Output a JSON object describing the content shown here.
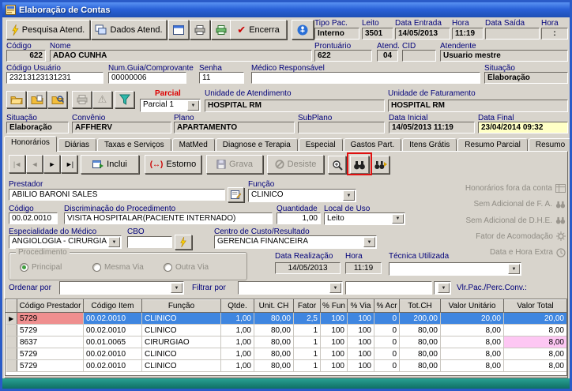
{
  "window": {
    "title": "Elaboração de Contas"
  },
  "icons": {
    "chevron_down": "▼",
    "check": "✔",
    "warning": "⚠",
    "prev_end": "|◄",
    "prev": "◄",
    "next": "►",
    "next_end": "►|",
    "estorno_glyph": "(↔)",
    "row_pointer": "▶"
  },
  "annotation_color": "#e01010",
  "toolbar": {
    "pesquisa_label": "Pesquisa Atend.",
    "dados_label": "Dados Atend.",
    "encerra_label": "Encerra"
  },
  "patient": {
    "tipo_pac_label": "Tipo Pac.",
    "tipo_pac": "Interno",
    "leito_label": "Leito",
    "leito": "3501",
    "data_entrada_label": "Data Entrada",
    "data_entrada": "14/05/2013",
    "hora_entrada_label": "Hora",
    "hora_entrada": "11:19",
    "data_saida_label": "Data Saída",
    "data_saida": "",
    "hora_saida_label": "Hora",
    "hora_saida": ":",
    "codigo_label": "Código",
    "codigo": "622",
    "nome_label": "Nome",
    "nome": "ADAO CUNHA",
    "prontuario_label": "Prontuário",
    "prontuario": "622",
    "atend_label": "Atend.",
    "atend": "04",
    "cid_label": "CID",
    "cid": "",
    "atendente_label": "Atendente",
    "atendente": "Usuario mestre",
    "codigo_usuario_label": "Código Usuário",
    "codigo_usuario": "23213123131231",
    "num_guia_label": "Num.Guia/Comprovante",
    "num_guia": "00000006",
    "senha_label": "Senha",
    "senha": "11",
    "medico_resp_label": "Médico Responsável",
    "medico_resp": "",
    "situacao_label": "Situação",
    "situacao": "Elaboração"
  },
  "conta": {
    "parcial_label": "Parcial",
    "parcial": "Parcial 1",
    "unid_atend_label": "Unidade de Atendimento",
    "unid_atend": "HOSPITAL RM",
    "unid_fat_label": "Unidade de Faturamento",
    "unid_fat": "HOSPITAL RM",
    "situacao_label": "Situação",
    "situacao": "Elaboração",
    "convenio_label": "Convênio",
    "convenio": "AFFHERV",
    "plano_label": "Plano",
    "plano": "APARTAMENTO",
    "subplano_label": "SubPlano",
    "subplano": "",
    "data_inicial_label": "Data Inicial",
    "data_inicial": "14/05/2013 11:19",
    "data_final_label": "Data Final",
    "data_final": "23/04/2014 09:32"
  },
  "tabs": {
    "items": [
      {
        "label": "Honorários",
        "active": true
      },
      {
        "label": "Diárias"
      },
      {
        "label": "Taxas e Serviços"
      },
      {
        "label": "MatMed"
      },
      {
        "label": "Diagnose e Terapia"
      },
      {
        "label": "Especial"
      },
      {
        "label": "Gastos Part."
      },
      {
        "label": "Itens Grátis"
      },
      {
        "label": "Resumo Parcial"
      },
      {
        "label": "Resumo"
      }
    ]
  },
  "honorarios": {
    "inclui": "Inclui",
    "estorno": "Estorno",
    "grava": "Grava",
    "desiste": "Desiste",
    "prestador_label": "Prestador",
    "prestador": "ABILIO BARONI SALES",
    "funcao_label": "Função",
    "funcao": "CLINICO",
    "codigo_label": "Código",
    "codigo": "00.02.0010",
    "discriminacao_label": "Discriminação do Procedimento",
    "discriminacao": "VISITA HOSPITALAR(PACIENTE INTERNADO)",
    "quantidade_label": "Quantidade",
    "quantidade": "1,00",
    "local_uso_label": "Local de Uso",
    "local_uso": "Leito",
    "especialidade_label": "Especialidade do Médico",
    "especialidade": "ANGIOLOGIA - CIRURGIA VA",
    "cbo_label": "CBO",
    "cbo": "",
    "centro_custo_label": "Centro de Custo/Resultado",
    "centro_custo": "GERENCIA FINANCEIRA",
    "procedimento_label": "Procedimento",
    "radio_principal": "Principal",
    "radio_mesma_via": "Mesma Via",
    "radio_outra_via": "Outra Via",
    "data_realizacao_label": "Data Realização",
    "data_realizacao": "14/05/2013",
    "hora_label": "Hora",
    "hora": "11:19",
    "tecnica_label": "Técnica Utilizada",
    "tecnica": "",
    "ordenar_label": "Ordenar por",
    "ordenar": "",
    "filtrar_label": "Filtrar por",
    "filtrar": "",
    "filtro_valor": "",
    "vlr_label": "Vlr.Pac./Perc.Conv.:"
  },
  "side_panel": {
    "items": [
      {
        "label": "Honorários fora da conta"
      },
      {
        "label": "Sem Adicional de F. A."
      },
      {
        "label": "Sem Adicional de D.H.E."
      },
      {
        "label": "Fator de Acomodação"
      },
      {
        "label": "Data e Hora Extra"
      }
    ]
  },
  "grid": {
    "selected_row": 0,
    "selected_bg": "#3f86e0",
    "selected_text_color": "#ffffff",
    "selected_first_cell_bg": "#ef8f8f",
    "pink_cell": {
      "row": 2,
      "key": "valor_total",
      "bg": "#fdc7f3"
    },
    "columns": [
      {
        "key": "ind",
        "label": "",
        "width": 14,
        "align": "center"
      },
      {
        "key": "codigo_prestador",
        "label": "Código Prestador",
        "width": 84,
        "align": "left"
      },
      {
        "key": "codigo_item",
        "label": "Código Item",
        "width": 74,
        "align": "left"
      },
      {
        "key": "funcao",
        "label": "Função",
        "width": 100,
        "align": "left"
      },
      {
        "key": "qtde",
        "label": "Qtde.",
        "width": 42,
        "align": "right"
      },
      {
        "key": "unit_ch",
        "label": "Unit. CH",
        "width": 50,
        "align": "right"
      },
      {
        "key": "fator",
        "label": "Fator",
        "width": 34,
        "align": "right"
      },
      {
        "key": "p_fun",
        "label": "% Fun",
        "width": 34,
        "align": "right"
      },
      {
        "key": "p_via",
        "label": "% Via",
        "width": 34,
        "align": "right"
      },
      {
        "key": "p_acr",
        "label": "% Acr",
        "width": 32,
        "align": "right"
      },
      {
        "key": "tot_ch",
        "label": "Tot.CH",
        "width": 52,
        "align": "right"
      },
      {
        "key": "valor_unitario",
        "label": "Valor Unitário",
        "width": 80,
        "align": "right"
      },
      {
        "key": "valor_total",
        "label": "Valor Total",
        "width": 80,
        "align": "right"
      }
    ],
    "rows": [
      {
        "codigo_prestador": "5729",
        "codigo_item": "00.02.0010",
        "funcao": "CLINICO",
        "qtde": "1,00",
        "unit_ch": "80,00",
        "fator": "2,5",
        "p_fun": "100",
        "p_via": "100",
        "p_acr": "0",
        "tot_ch": "200,00",
        "valor_unitario": "20,00",
        "valor_total": "20,00"
      },
      {
        "codigo_prestador": "5729",
        "codigo_item": "00.02.0010",
        "funcao": "CLINICO",
        "qtde": "1,00",
        "unit_ch": "80,00",
        "fator": "1",
        "p_fun": "100",
        "p_via": "100",
        "p_acr": "0",
        "tot_ch": "80,00",
        "valor_unitario": "8,00",
        "valor_total": "8,00"
      },
      {
        "codigo_prestador": "8637",
        "codigo_item": "00.01.0065",
        "funcao": "CIRURGIAO",
        "qtde": "1,00",
        "unit_ch": "80,00",
        "fator": "1",
        "p_fun": "100",
        "p_via": "100",
        "p_acr": "0",
        "tot_ch": "80,00",
        "valor_unitario": "8,00",
        "valor_total": "8,00"
      },
      {
        "codigo_prestador": "5729",
        "codigo_item": "00.02.0010",
        "funcao": "CLINICO",
        "qtde": "1,00",
        "unit_ch": "80,00",
        "fator": "1",
        "p_fun": "100",
        "p_via": "100",
        "p_acr": "0",
        "tot_ch": "80,00",
        "valor_unitario": "8,00",
        "valor_total": "8,00"
      },
      {
        "codigo_prestador": "5729",
        "codigo_item": "00.02.0010",
        "funcao": "CLINICO",
        "qtde": "1,00",
        "unit_ch": "80,00",
        "fator": "1",
        "p_fun": "100",
        "p_via": "100",
        "p_acr": "0",
        "tot_ch": "80,00",
        "valor_unitario": "8,00",
        "valor_total": "8,00"
      }
    ]
  }
}
